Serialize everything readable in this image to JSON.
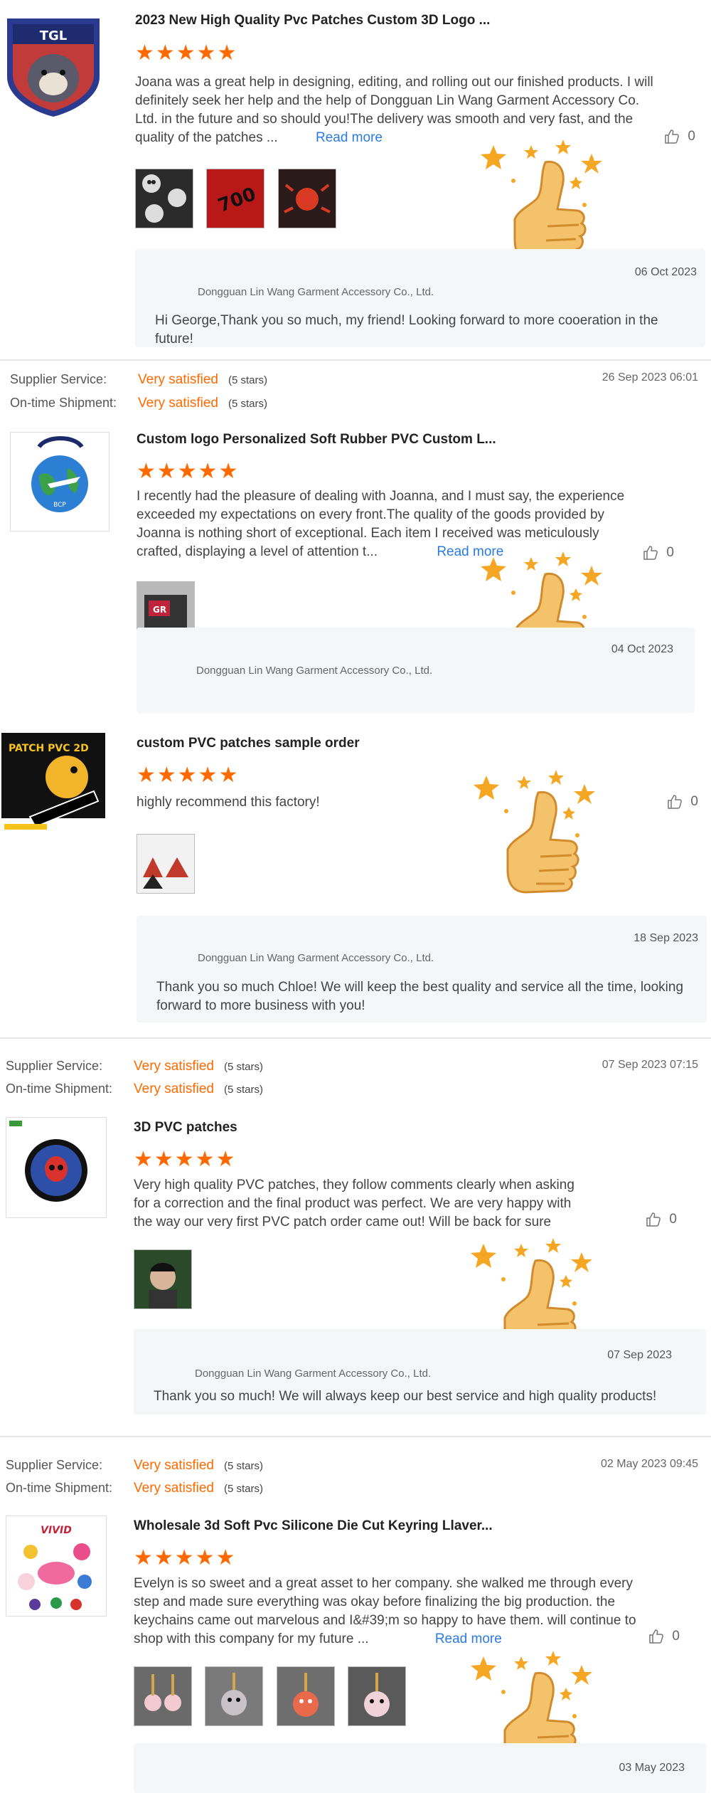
{
  "reviews": [
    {
      "title": "2023 New High Quality Pvc Patches Custom 3D Logo ...",
      "stars": "★★★★★",
      "body": "Joana was a great help in designing, editing, and rolling out our finished products. I will definitely seek her help and the help of Dongguan Lin Wang Garment Accessory Co. Ltd. in the future and so should you!The delivery was smooth and very fast, and the quality of the patches ...",
      "read_more": "Read more",
      "likes": "0",
      "reply": {
        "date": "06 Oct 2023",
        "company": "Dongguan Lin Wang Garment Accessory Co., Ltd.",
        "text": "Hi George,Thank you so much, my friend! Looking forward to more cooeration in the future!"
      }
    },
    {
      "supplier_label": "Supplier Service:",
      "supplier_value": "Very satisfied",
      "supplier_stars": "(5 stars)",
      "shipment_label": "On-time Shipment:",
      "shipment_value": "Very satisfied",
      "shipment_stars": "(5 stars)",
      "date": "26 Sep 2023 06:01",
      "title": "Custom logo Personalized Soft Rubber PVC Custom L...",
      "stars": "★★★★★",
      "body": "I recently had the pleasure of dealing with Joanna, and I must say, the experience exceeded my expectations on every front.The quality of the goods provided by Joanna is nothing short of exceptional. Each item I received was meticulously crafted, displaying a level of attention t...",
      "read_more": "Read more",
      "likes": "0",
      "reply": {
        "date": "04 Oct 2023",
        "company": "Dongguan Lin Wang Garment Accessory Co., Ltd.",
        "text": ""
      }
    },
    {
      "title": "custom PVC patches sample order",
      "stars": "★★★★★",
      "body": "highly recommend this factory!",
      "likes": "0",
      "thumb_text": "PATCH PVC 2D",
      "reply": {
        "date": "18 Sep 2023",
        "company": "Dongguan Lin Wang Garment Accessory Co., Ltd.",
        "text": "Thank you so much Chloe! We will keep the best quality and service all the time, looking forward to more business with you!"
      }
    },
    {
      "supplier_label": "Supplier Service:",
      "supplier_value": "Very satisfied",
      "supplier_stars": "(5 stars)",
      "shipment_label": "On-time Shipment:",
      "shipment_value": "Very satisfied",
      "shipment_stars": "(5 stars)",
      "date": "07 Sep 2023 07:15",
      "title": "3D PVC patches",
      "stars": "★★★★★",
      "body": "Very high quality PVC patches, they follow comments clearly when asking for a correction and the final product was perfect.  We are very happy with the way our very first PVC patch order came out!  Will be back for sure",
      "likes": "0",
      "reply": {
        "date": "07 Sep 2023",
        "company": "Dongguan Lin Wang Garment Accessory Co., Ltd.",
        "text": "Thank you so much! We will always keep our best service and high quality products!"
      }
    },
    {
      "supplier_label": "Supplier Service:",
      "supplier_value": "Very satisfied",
      "supplier_stars": "(5 stars)",
      "shipment_label": "On-time Shipment:",
      "shipment_value": "Very satisfied",
      "shipment_stars": "(5 stars)",
      "date": "02 May 2023 09:45",
      "title": "Wholesale 3d Soft Pvc Silicone Die Cut Keyring Llaver...",
      "stars": "★★★★★",
      "body": "Evelyn is so sweet and a great asset to her company. she walked me through every step and made sure everything was okay before finalizing the big production. the keychains came out marvelous and I&#39;m so happy to have them. will continue to shop with this company for my future ...",
      "read_more": "Read more",
      "likes": "0",
      "thumb_text": "VIVID",
      "reply": {
        "date": "03 May 2023",
        "company": "",
        "text": ""
      }
    }
  ],
  "colors": {
    "accent": "#ff6a00",
    "link": "#2a7ae2",
    "reply_bg": "#f5f6f8"
  }
}
